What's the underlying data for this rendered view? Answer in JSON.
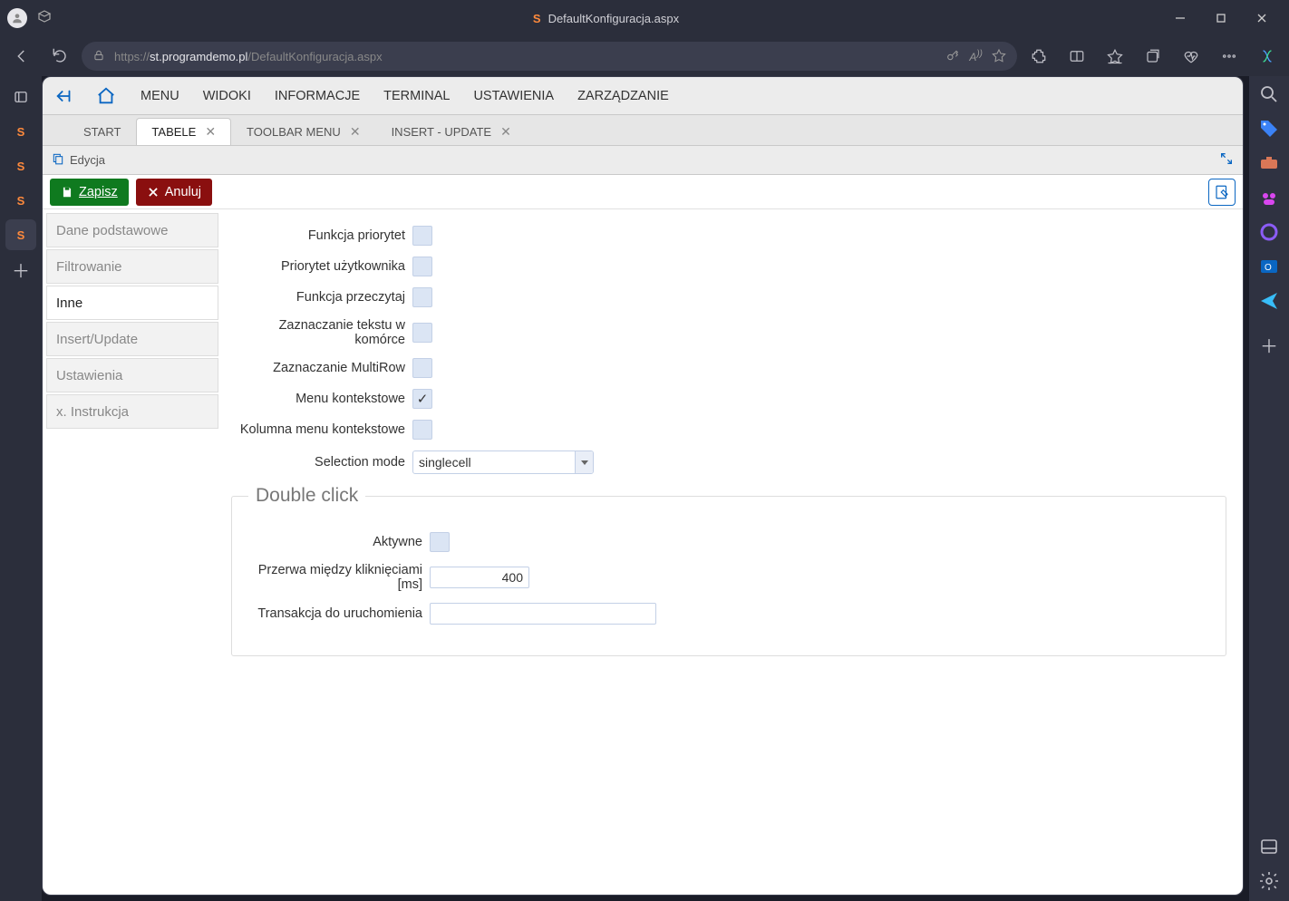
{
  "browser": {
    "page_title": "DefaultKonfiguracja.aspx",
    "url_host": "st.programdemo.pl",
    "url_prefix": "https://",
    "url_path": "/DefaultKonfiguracja.aspx"
  },
  "app": {
    "menu": [
      "MENU",
      "WIDOKI",
      "INFORMACJE",
      "TERMINAL",
      "USTAWIENIA",
      "ZARZĄDZANIE"
    ],
    "tabs": [
      {
        "label": "START",
        "closable": false
      },
      {
        "label": "TABELE",
        "closable": true,
        "active": true
      },
      {
        "label": "TOOLBAR MENU",
        "closable": true
      },
      {
        "label": "INSERT - UPDATE",
        "closable": true
      }
    ],
    "crumb": "Edycja",
    "buttons": {
      "save": "Zapisz",
      "cancel": "Anuluj"
    },
    "side_nav": [
      {
        "label": "Dane podstawowe"
      },
      {
        "label": "Filtrowanie"
      },
      {
        "label": "Inne",
        "active": true
      },
      {
        "label": "Insert/Update"
      },
      {
        "label": "Ustawienia"
      },
      {
        "label": "x. Instrukcja"
      }
    ]
  },
  "form": {
    "funkcja_priorytet": {
      "label": "Funkcja priorytet",
      "checked": false
    },
    "priorytet_uzytkownika": {
      "label": "Priorytet użytkownika",
      "checked": false
    },
    "funkcja_przeczytaj": {
      "label": "Funkcja przeczytaj",
      "checked": false
    },
    "zazn_tekst_komorka": {
      "label": "Zaznaczanie tekstu w komórce",
      "checked": false
    },
    "zazn_multirow": {
      "label": "Zaznaczanie MultiRow",
      "checked": false
    },
    "menu_kontekstowe": {
      "label": "Menu kontekstowe",
      "checked": true
    },
    "kolumna_menu_kontekstowe": {
      "label": "Kolumna menu kontekstowe",
      "checked": false
    },
    "selection_mode": {
      "label": "Selection mode",
      "value": "singlecell"
    },
    "double_click": {
      "legend": "Double click",
      "aktywne": {
        "label": "Aktywne",
        "checked": false
      },
      "przerwa": {
        "label": "Przerwa między kliknięciami [ms]",
        "value": "400"
      },
      "transakcja": {
        "label": "Transakcja do uruchomienia",
        "value": ""
      }
    }
  },
  "vertical_tabs": {
    "badge": "S"
  }
}
